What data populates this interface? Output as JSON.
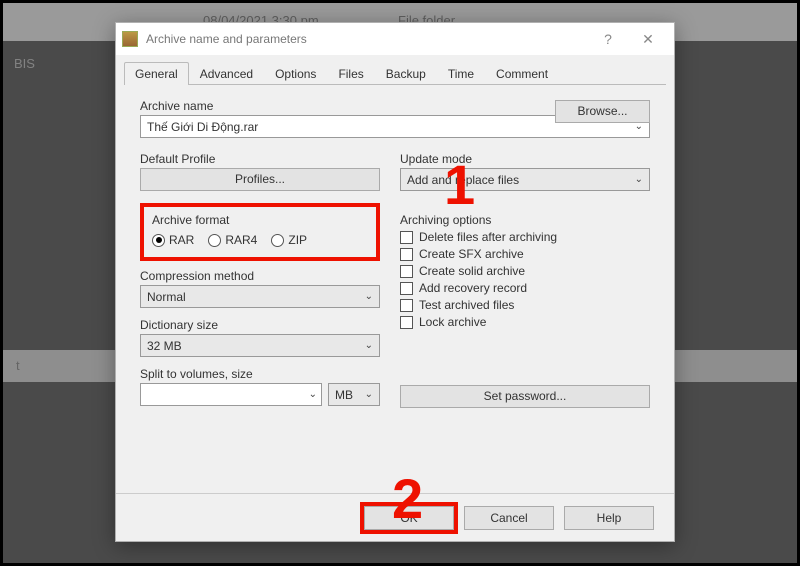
{
  "background": {
    "date": "08/04/2021 3:30 pm",
    "type": "File folder",
    "item1": "BIS",
    "item2": "t"
  },
  "titlebar": {
    "title": "Archive name and parameters"
  },
  "tabs": [
    "General",
    "Advanced",
    "Options",
    "Files",
    "Backup",
    "Time",
    "Comment"
  ],
  "active_tab": 0,
  "archive_name_label": "Archive name",
  "browse_label": "Browse...",
  "archive_name_value": "Thế Giới Di Động.rar",
  "default_profile_label": "Default Profile",
  "profiles_button": "Profiles...",
  "update_mode_label": "Update mode",
  "update_mode_value": "Add and replace files",
  "archive_format": {
    "label": "Archive format",
    "options": [
      "RAR",
      "RAR4",
      "ZIP"
    ],
    "selected": "RAR"
  },
  "compression_method_label": "Compression method",
  "compression_method_value": "Normal",
  "dictionary_size_label": "Dictionary size",
  "dictionary_size_value": "32 MB",
  "split_label": "Split to volumes, size",
  "split_value": "",
  "split_unit": "MB",
  "archiving_options_label": "Archiving options",
  "archiving_options": [
    "Delete files after archiving",
    "Create SFX archive",
    "Create solid archive",
    "Add recovery record",
    "Test archived files",
    "Lock archive"
  ],
  "set_password_label": "Set password...",
  "buttons": {
    "ok": "OK",
    "cancel": "Cancel",
    "help": "Help"
  },
  "callouts": {
    "one": "1",
    "two": "2"
  }
}
